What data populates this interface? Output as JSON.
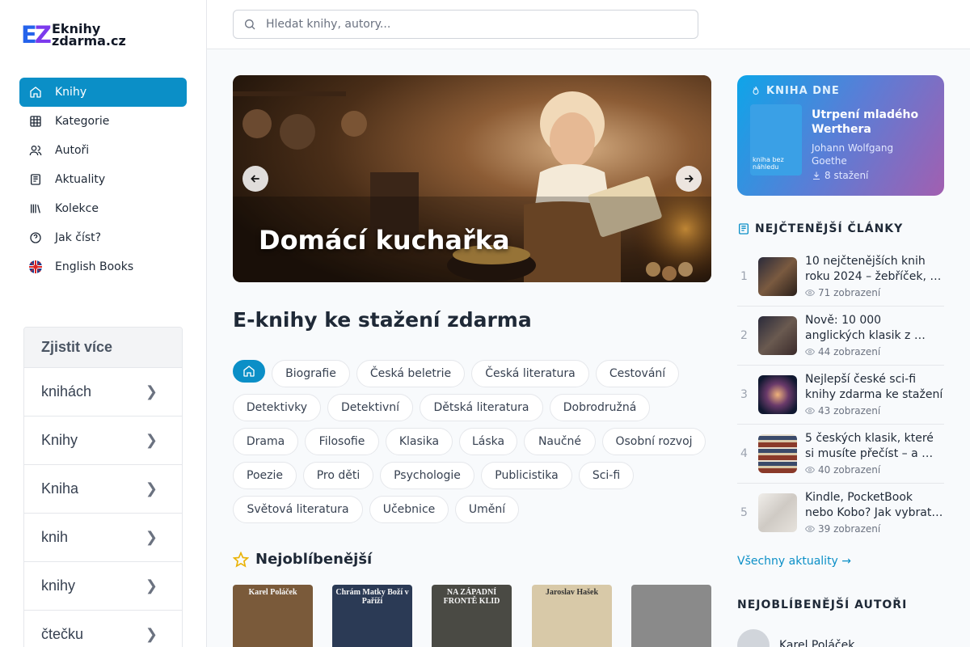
{
  "logo": {
    "mark": "EZ",
    "line1": "Eknihy",
    "line2": "zdarma.cz"
  },
  "nav": [
    {
      "label": "Knihy",
      "icon": "home-icon",
      "active": true
    },
    {
      "label": "Kategorie",
      "icon": "grid-icon"
    },
    {
      "label": "Autoři",
      "icon": "users-icon"
    },
    {
      "label": "Aktuality",
      "icon": "newspaper-icon"
    },
    {
      "label": "Kolekce",
      "icon": "library-icon"
    },
    {
      "label": "Jak číst?",
      "icon": "help-circle-icon"
    },
    {
      "label": "English Books",
      "icon": "uk-flag-icon"
    }
  ],
  "more": {
    "title": "Zjistit více",
    "items": [
      "knihách",
      "Knihy",
      "Kniha",
      "knih",
      "knihy",
      "čtečku"
    ]
  },
  "search": {
    "placeholder": "Hledat knihy, autory..."
  },
  "hero": {
    "title": "Domácí kuchařka"
  },
  "main": {
    "title": "E-knihy ke stažení zdarma",
    "popular_title": "Nejoblíbenější"
  },
  "categories": [
    "Biografie",
    "Česká beletrie",
    "Česká literatura",
    "Cestování",
    "Detektivky",
    "Detektivní",
    "Dětská literatura",
    "Dobrodružná",
    "Drama",
    "Filosofie",
    "Klasika",
    "Láska",
    "Naučné",
    "Osobní rozvoj",
    "Poezie",
    "Pro děti",
    "Psychologie",
    "Publicistika",
    "Sci-fi",
    "Světová literatura",
    "Učebnice",
    "Umění"
  ],
  "books": [
    {
      "label": "Karel Poláček",
      "color": "#7a5a3a"
    },
    {
      "label": "Chrám Matky Boží v Paříži",
      "color": "#2b3a55"
    },
    {
      "label": "NA ZÁPADNÍ FRONTĚ KLID",
      "color": "#4a4a44"
    },
    {
      "label": "Jaroslav Hašek",
      "color": "#d8c9a8"
    },
    {
      "label": "",
      "color": "#8a8a8a"
    }
  ],
  "book_of_day": {
    "tag": "KNIHA DNE",
    "cover_text": "kniha bez náhledu",
    "title": "Utrpení mladého Werthera",
    "author": "Johann Wolfgang Goethe",
    "downloads": "8 stažení"
  },
  "articles_head": "NEJČTENĚJŠÍ ČLÁNKY",
  "articles": [
    {
      "num": "1",
      "title": "10 nejčtenějších knih roku 2024 – žebříček, …",
      "views": "71 zobrazení",
      "color": "#4b3a30"
    },
    {
      "num": "2",
      "title": "Nově: 10 000 anglických klasik z …",
      "views": "44 zobrazení",
      "color": "#3d3a44"
    },
    {
      "num": "3",
      "title": "Nejlepší české sci-fi knihy zdarma ke stažení",
      "views": "43 zobrazení",
      "color": "#2a2a4a"
    },
    {
      "num": "4",
      "title": "5 českých klasik, které si musíte přečíst – a …",
      "views": "40 zobrazení",
      "color": "#8a4a3a"
    },
    {
      "num": "5",
      "title": "Kindle, PocketBook nebo Kobo? Jak vybrat…",
      "views": "39 zobrazení",
      "color": "#d8d4cf"
    }
  ],
  "all_news": "Všechny aktuality →",
  "authors_head": "NEJOBLÍBENĚJŠÍ AUTOŘI",
  "top_author": "Karel Poláček"
}
